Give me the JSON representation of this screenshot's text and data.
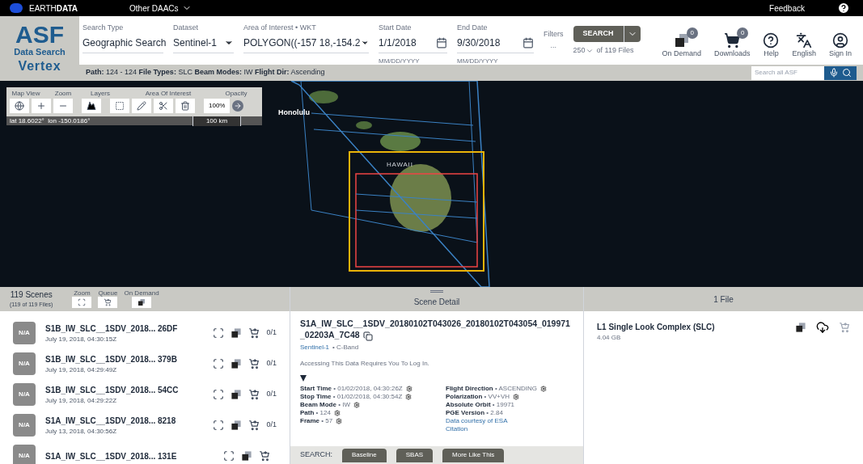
{
  "top_bar": {
    "brand": "EARTH**DATA**",
    "menu": "Other DAACs",
    "feedback": "Feedback"
  },
  "logo": {
    "title": "ASF",
    "subtitle": "Data Search",
    "name": "Vertex"
  },
  "search_type": {
    "label": "Search Type",
    "value": "Geographic Search"
  },
  "dataset": {
    "label": "Dataset",
    "value": "Sentinel-1"
  },
  "area_of_interest": {
    "label": "Area of Interest • WKT",
    "value": "POLYGON((-157 18,-154.2"
  },
  "start_date": {
    "label": "Start Date",
    "value": "1/1/2018",
    "hint": "MM/DD/YYYY"
  },
  "end_date": {
    "label": "End Date",
    "value": "9/30/2018",
    "hint": "MM/DD/YYYY"
  },
  "filters": {
    "label": "Filters",
    "more": "..."
  },
  "search_button": "SEARCH",
  "max_results": {
    "value": "250",
    "total": "of 119 Files"
  },
  "nav": [
    {
      "kind": "ondemand",
      "label": "On Demand",
      "badge": "0"
    },
    {
      "kind": "cart",
      "label": "Downloads",
      "badge": "0"
    },
    {
      "kind": "help",
      "label": "Help"
    },
    {
      "kind": "language",
      "label": "English"
    },
    {
      "kind": "user",
      "label": "Sign In"
    }
  ],
  "filter_summary": "**Path:** 124 - 124 **File Types:** SLC **Beam Modes:** IW **Flight Dir:** Ascending",
  "site_search": {
    "placeholder": "Search all ASF"
  },
  "map_toolbar": {
    "groups": [
      "Map View",
      "Zoom",
      "Layers",
      "Area Of Interest",
      "Opacity"
    ],
    "opacity": "100%",
    "coordinates": "lat 18.6022°  lon -150.0186°",
    "scale": "100 km"
  },
  "map_labels": [
    {
      "kind": "city",
      "text": "Honolulu"
    },
    {
      "kind": "region",
      "text": "HAWAII"
    }
  ],
  "scenes_panel": {
    "title": "119 Scenes",
    "subtitle": "(119 of 119 Files)",
    "tools": [
      "Zoom",
      "Queue",
      "On Demand"
    ]
  },
  "scenes": [
    {
      "thumb": "N/A",
      "name": "S1B_IW_SLC__1SDV_2018... 26DF",
      "date": "July 19, 2018, 04:30:15Z",
      "count": "0/1"
    },
    {
      "thumb": "N/A",
      "name": "S1B_IW_SLC__1SDV_2018... 379B",
      "date": "July 19, 2018, 04:29:49Z",
      "count": "0/1"
    },
    {
      "thumb": "N/A",
      "name": "S1B_IW_SLC__1SDV_2018... 54CC",
      "date": "July 19, 2018, 04:29:22Z",
      "count": "0/1"
    },
    {
      "thumb": "N/A",
      "name": "S1A_IW_SLC__1SDV_2018... 8218",
      "date": "July 13, 2018, 04:30:56Z",
      "count": "0/1"
    },
    {
      "thumb": "N/A",
      "name": "S1A_IW_SLC__1SDV_2018... 131E"
    }
  ],
  "scene_detail": {
    "header": "Scene Detail",
    "title": "S1A_IW_SLC__1SDV_20180102T043026_20180102T043054_019971_02203A_7C48",
    "platform": "Sentinel-1",
    "band": "• C-Band",
    "notice": "Accessing This Data Requires You To Log In.",
    "properties_left": [
      {
        "name": "Start Time",
        "value": "• 01/02/2018, 04:30:26Z",
        "gear": true
      },
      {
        "name": "Stop Time",
        "value": "• 01/02/2018, 04:30:54Z",
        "gear": true
      },
      {
        "name": "Beam Mode",
        "value": "• IW",
        "gear": true
      },
      {
        "name": "Path",
        "value": "• 124",
        "gear": true
      },
      {
        "name": "Frame",
        "value": "• 57",
        "gear": true
      }
    ],
    "properties_right": [
      {
        "name": "Flight Direction",
        "value": "• ASCENDING",
        "gear": true
      },
      {
        "name": "Polarization",
        "value": "• VV+VH",
        "gear": true
      },
      {
        "name": "Absolute Orbit",
        "value": "• 19971",
        "gear": false
      },
      {
        "name": "PGE Version",
        "value": "• 2.84",
        "gear": false
      }
    ],
    "links": [
      "Data courtesy of ESA",
      "Citation"
    ],
    "search_label": "SEARCH:",
    "search_buttons": [
      "Baseline",
      "SBAS",
      "More Like This"
    ]
  },
  "files_panel": {
    "header": "1 File",
    "files": [
      {
        "name": "L1 Single Look Complex (SLC)",
        "size": "4.04 GB"
      }
    ]
  }
}
